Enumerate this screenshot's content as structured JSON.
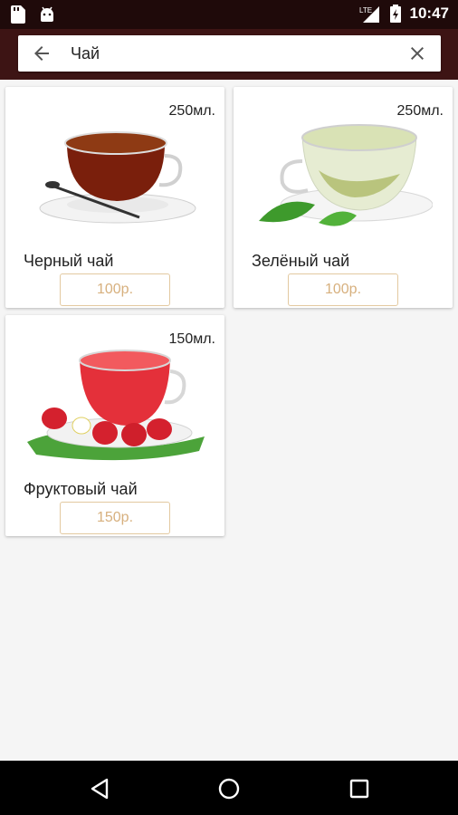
{
  "status_bar": {
    "time": "10:47",
    "left_icons": [
      "sd-card-icon",
      "android-debug-icon"
    ],
    "right_icons": [
      "signal-lte-icon",
      "battery-charging-icon"
    ],
    "network_label": "LTE"
  },
  "search": {
    "query": "Чай"
  },
  "products": [
    {
      "volume": "250мл.",
      "name": "Черный чай",
      "price": "100р.",
      "image": "black-tea-cup-image"
    },
    {
      "volume": "250мл.",
      "name": "Зелёный чай",
      "price": "100р.",
      "image": "green-tea-cup-image"
    },
    {
      "volume": "150мл.",
      "name": "Фруктовый чай",
      "price": "150р.",
      "image": "fruit-tea-cup-image"
    }
  ],
  "colors": {
    "status_bar": "#1f0a0a",
    "toolbar": "#3d1414",
    "price_text": "#d7b07e",
    "price_border": "#e3c9a0"
  }
}
